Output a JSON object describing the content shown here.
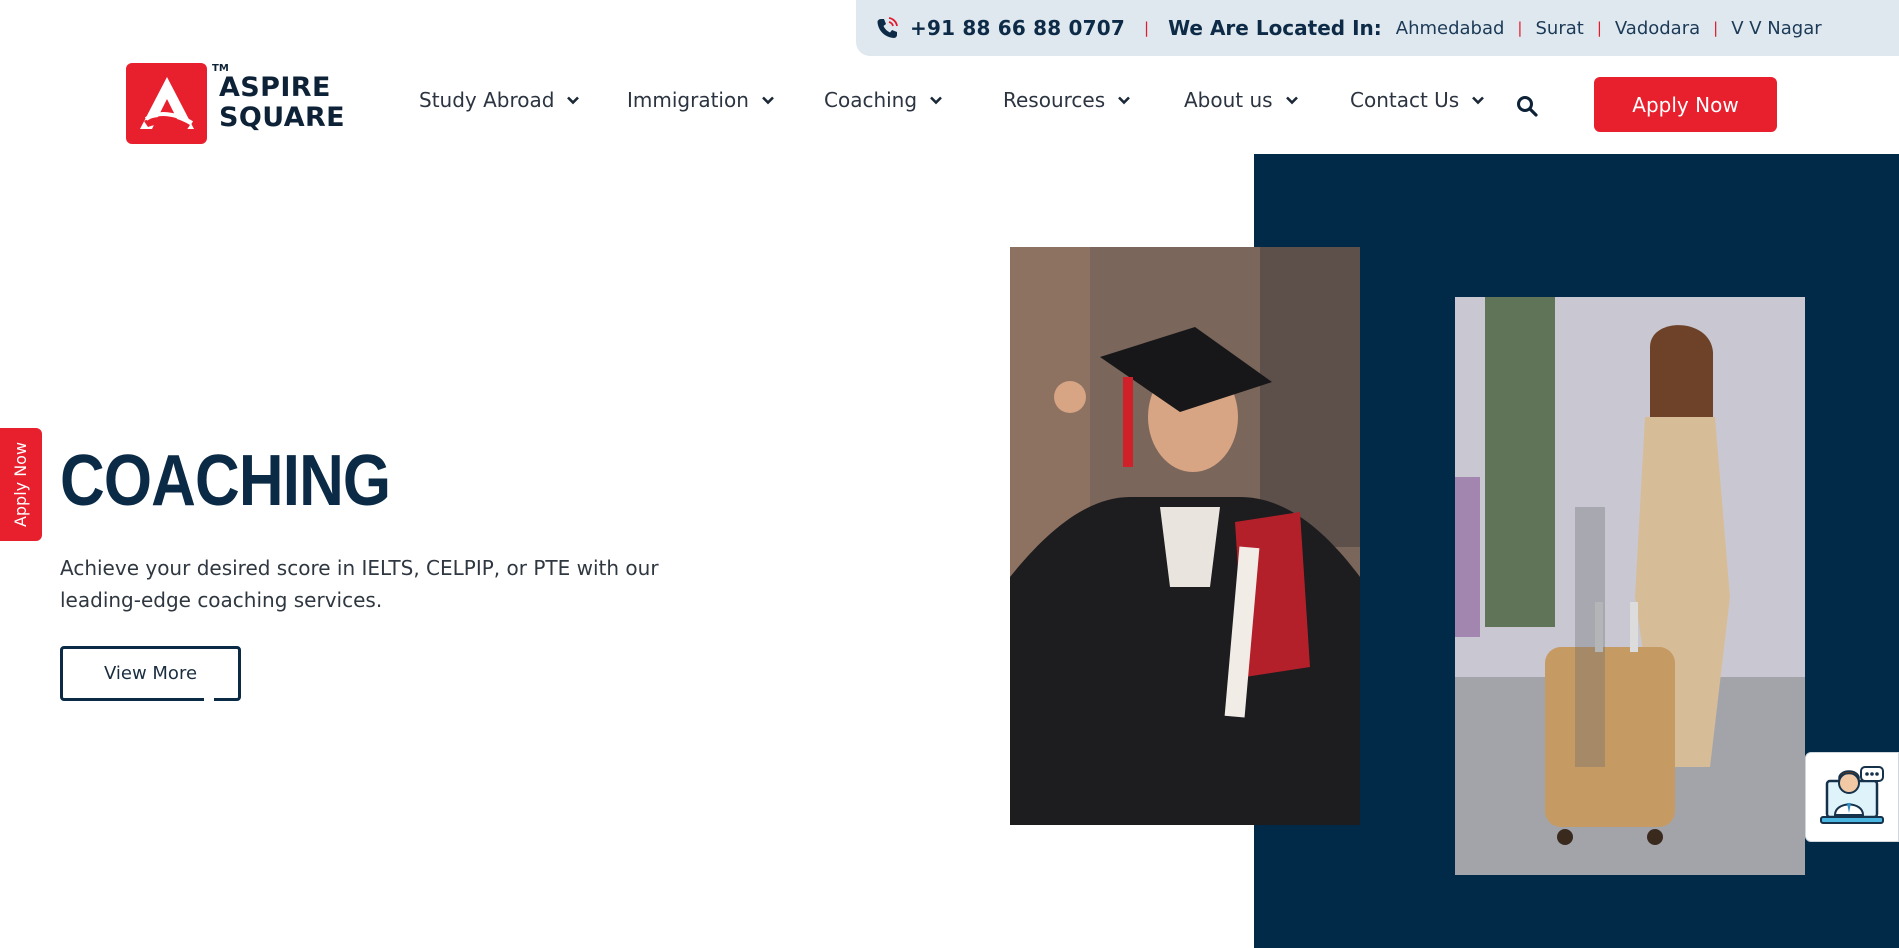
{
  "topbar": {
    "phone": "+91 88 66 88 0707",
    "location_label": "We Are Located In:",
    "cities": [
      "Ahmedabad",
      "Surat",
      "Vadodara",
      "V V Nagar"
    ]
  },
  "logo": {
    "tm": "TM",
    "line1": "ASPIRE",
    "line2": "SQUARE"
  },
  "nav": {
    "items": [
      {
        "label": "Study Abroad"
      },
      {
        "label": "Immigration"
      },
      {
        "label": "Coaching"
      },
      {
        "label": "Resources"
      },
      {
        "label": "About us"
      },
      {
        "label": "Contact Us"
      }
    ],
    "apply_label": "Apply Now"
  },
  "hero": {
    "title": "COACHING",
    "description": "Achieve your desired score in IELTS, CELPIP, or PTE with our leading-edge coaching services.",
    "button_label": "View More"
  },
  "side_tab": {
    "label": "Apply Now"
  },
  "colors": {
    "brand_red": "#e8202e",
    "navy": "#002a47",
    "topbar_bg": "#dfe8ef"
  }
}
